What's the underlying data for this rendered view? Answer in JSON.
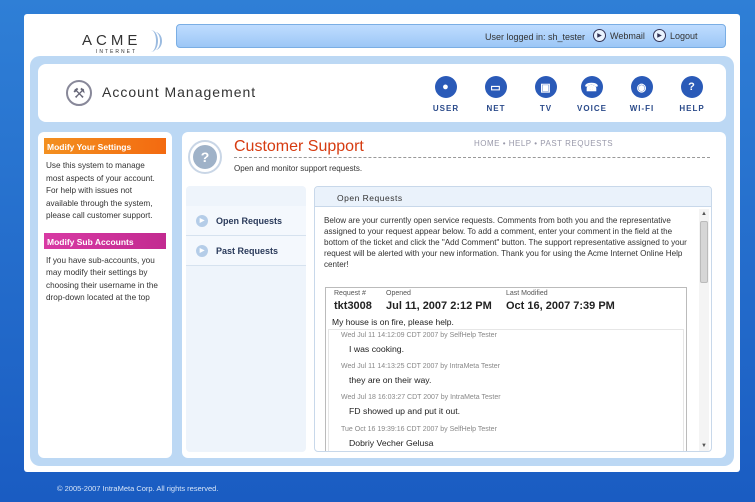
{
  "logo": {
    "word": "ACME",
    "sub": "INTERNET"
  },
  "topbar": {
    "user_text": "User logged in: sh_tester",
    "webmail_label": "Webmail",
    "logout_label": "Logout"
  },
  "header": {
    "title": "Account Management",
    "nav": [
      {
        "label": "USER",
        "icon": "user-icon"
      },
      {
        "label": "NET",
        "icon": "monitor-icon"
      },
      {
        "label": "TV",
        "icon": "tv-icon"
      },
      {
        "label": "VOICE",
        "icon": "phone-icon"
      },
      {
        "label": "WI-FI",
        "icon": "wifi-icon"
      },
      {
        "label": "HELP",
        "icon": "help-icon"
      }
    ]
  },
  "sidebar": {
    "settings_title": "Modify Your Settings",
    "settings_text": "Use this system to manage most aspects of your account.  For help with issues not available through the system, please call customer support.",
    "sub_title": "Modify Sub Accounts",
    "sub_text": "If you have sub-accounts, you may modify their settings by choosing their username in the drop-down located at the top"
  },
  "main": {
    "title": "Customer Support",
    "breadcrumb": "HOME • HELP • PAST REQUESTS",
    "subtitle": "Open and monitor support requests.",
    "tabs": [
      {
        "label": "Open Requests"
      },
      {
        "label": "Past Requests"
      }
    ],
    "content_heading": "Open Requests",
    "intro": "Below are your currently open service requests.  Comments from both you and the representative assigned to your request appear below.  To add a comment, enter your comment in the field at the bottom of the ticket and click the \"Add Comment\" button.  The support representative assigned to your request will be alerted with your new information.  Thank you for using the Acme Internet Online Help center!"
  },
  "ticket": {
    "headers": {
      "request": "Request #",
      "opened": "Opened",
      "modified": "Last Modified"
    },
    "request_no": "tkt3008",
    "opened": "Jul 11, 2007 2:12 PM",
    "modified": "Oct 16, 2007 7:39 PM",
    "description": "My house is on fire, please help.",
    "comments": [
      {
        "meta": "Wed Jul 11 14:12:09 CDT 2007 by SelfHelp Tester",
        "text": "I was cooking."
      },
      {
        "meta": "Wed Jul 11 14:13:25 CDT 2007 by IntraMeta Tester",
        "text": "they are on their way."
      },
      {
        "meta": "Wed Jul 18 16:03:27 CDT 2007 by IntraMeta Tester",
        "text": "FD showed up and put it out."
      },
      {
        "meta": "Tue Oct 16 19:39:16 CDT 2007 by SelfHelp Tester",
        "text": "Dobriy Vecher Gelusa"
      }
    ]
  },
  "footer": {
    "text": "© 2005-2007 IntraMeta Corp. All rights reserved."
  }
}
